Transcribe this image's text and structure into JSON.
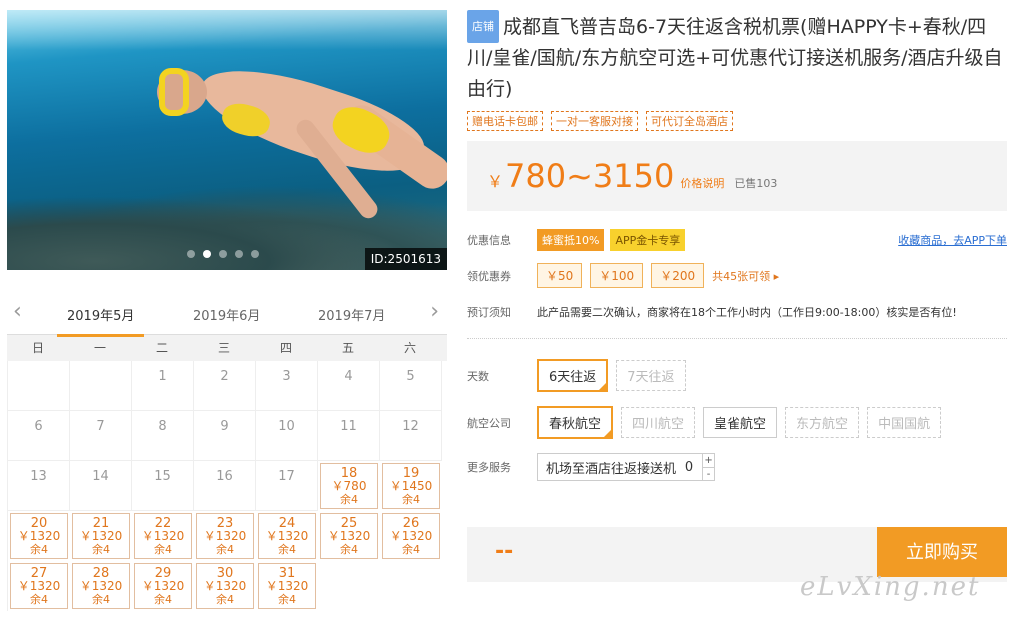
{
  "gallery": {
    "id_tag": "ID:2501613",
    "dots": 5,
    "active_dot": 1
  },
  "calendar": {
    "months": [
      "2019年5月",
      "2019年6月",
      "2019年7月"
    ],
    "active_month": 0,
    "weekdays": [
      "日",
      "一",
      "二",
      "三",
      "四",
      "五",
      "六"
    ],
    "leading_blank": 2,
    "days": [
      {
        "d": "1"
      },
      {
        "d": "2"
      },
      {
        "d": "3"
      },
      {
        "d": "4"
      },
      {
        "d": "5"
      },
      {
        "d": "6"
      },
      {
        "d": "7"
      },
      {
        "d": "8"
      },
      {
        "d": "9"
      },
      {
        "d": "10"
      },
      {
        "d": "11"
      },
      {
        "d": "12"
      },
      {
        "d": "13"
      },
      {
        "d": "14"
      },
      {
        "d": "15"
      },
      {
        "d": "16"
      },
      {
        "d": "17"
      },
      {
        "d": "18",
        "p": "￥780",
        "r": "余4"
      },
      {
        "d": "19",
        "p": "￥1450",
        "r": "余4"
      },
      {
        "d": "20",
        "p": "￥1320",
        "r": "余4"
      },
      {
        "d": "21",
        "p": "￥1320",
        "r": "余4"
      },
      {
        "d": "22",
        "p": "￥1320",
        "r": "余4"
      },
      {
        "d": "23",
        "p": "￥1320",
        "r": "余4"
      },
      {
        "d": "24",
        "p": "￥1320",
        "r": "余4"
      },
      {
        "d": "25",
        "p": "￥1320",
        "r": "余4"
      },
      {
        "d": "26",
        "p": "￥1320",
        "r": "余4"
      },
      {
        "d": "27",
        "p": "￥1320",
        "r": "余4"
      },
      {
        "d": "28",
        "p": "￥1320",
        "r": "余4"
      },
      {
        "d": "29",
        "p": "￥1320",
        "r": "余4"
      },
      {
        "d": "30",
        "p": "￥1320",
        "r": "余4"
      },
      {
        "d": "31",
        "p": "￥1320",
        "r": "余4"
      }
    ]
  },
  "product": {
    "shop_badge": "店铺",
    "title": "成都直飞普吉岛6-7天往返含税机票(赠HAPPY卡+春秋/四川/皇雀/国航/东方航空可选+可优惠代订接送机服务/酒店升级自由行)",
    "tags": [
      "赠电话卡包邮",
      "一对一客服对接",
      "可代订全岛酒店"
    ],
    "currency": "￥",
    "price": "780~3150",
    "price_note": "价格说明",
    "sold": "已售103"
  },
  "promo": {
    "label": "优惠信息",
    "chip1": "蜂蜜抵10%",
    "chip2": "APP金卡专享",
    "fav": "收藏商品，去APP下单"
  },
  "coupons": {
    "label": "领优惠券",
    "items": [
      "￥50",
      "￥100",
      "￥200"
    ],
    "more": "共45张可领 ▸"
  },
  "notice": {
    "label": "预订须知",
    "text": "此产品需要二次确认，商家将在18个工作小时内（工作日9:00-18:00）核实是否有位!"
  },
  "days": {
    "label": "天数",
    "options": [
      "6天往返",
      "7天往返"
    ]
  },
  "airline": {
    "label": "航空公司",
    "options": [
      "春秋航空",
      "四川航空",
      "皇雀航空",
      "东方航空",
      "中国国航"
    ]
  },
  "service": {
    "label": "更多服务",
    "name": "机场至酒店往返接送机",
    "count": "0",
    "plus": "+",
    "minus": "-"
  },
  "buy": {
    "total": "--",
    "button": "立即购买"
  },
  "watermark": "eLvXing.net",
  "colors": {
    "accent": "#f29b24",
    "price": "#f07d17",
    "link": "#2a6ed2"
  }
}
